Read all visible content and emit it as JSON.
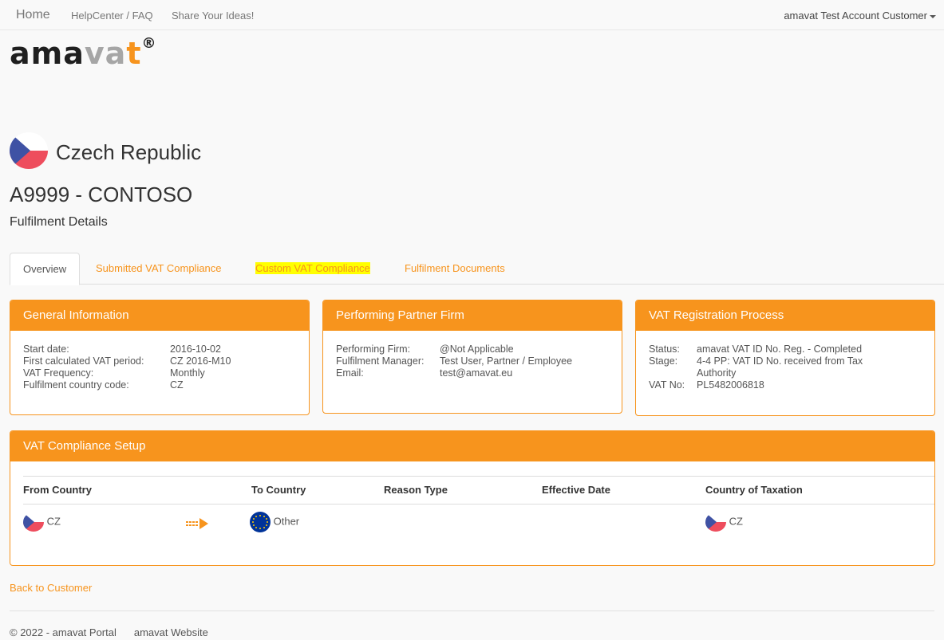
{
  "nav": {
    "home": "Home",
    "links": [
      "HelpCenter / FAQ",
      "Share Your Ideas!"
    ],
    "user": "amavat Test Account Customer"
  },
  "logo": {
    "part1": "ama",
    "part2": "va",
    "part3": "t",
    "reg": "®"
  },
  "country": {
    "name": "Czech Republic",
    "flag_icon": "czech-flag-icon"
  },
  "client": {
    "title": "A9999 - CONTOSO",
    "subtitle": "Fulfilment Details"
  },
  "tabs": [
    {
      "label": "Overview",
      "active": true
    },
    {
      "label": "Submitted VAT Compliance",
      "active": false
    },
    {
      "label": "Custom VAT Compliance",
      "active": false,
      "highlighted": true
    },
    {
      "label": "Fulfilment Documents",
      "active": false
    }
  ],
  "general": {
    "heading": "General Information",
    "rows": [
      {
        "k": "Start date:",
        "v": "2016-10-02"
      },
      {
        "k": "First calculated VAT period:",
        "v": "CZ 2016-M10"
      },
      {
        "k": "VAT Frequency:",
        "v": "Monthly"
      },
      {
        "k": "Fulfilment country code:",
        "v": "CZ"
      }
    ]
  },
  "partner": {
    "heading": "Performing Partner Firm",
    "rows": [
      {
        "k": "Performing Firm:",
        "v": "@Not Applicable"
      },
      {
        "k": "Fulfilment Manager:",
        "v": "Test User, Partner / Employee"
      },
      {
        "k": "Email:",
        "v": "test@amavat.eu"
      }
    ]
  },
  "registration": {
    "heading": "VAT Registration Process",
    "rows": [
      {
        "k": "Status:",
        "v": "amavat VAT ID No. Reg. - Completed"
      },
      {
        "k": "Stage:",
        "v": "4-4 PP: VAT ID No. received from Tax Authority"
      },
      {
        "k": "VAT No:",
        "v": "PL5482006818"
      }
    ]
  },
  "setup": {
    "heading": "VAT Compliance Setup",
    "columns": [
      "From Country",
      "To Country",
      "Reason Type",
      "Effective Date",
      "Country of Taxation"
    ],
    "row": {
      "from": "CZ",
      "arrow_icon": "arrow-right-icon",
      "to": "Other",
      "reason": "",
      "effective": "",
      "taxation": "CZ"
    }
  },
  "footer": {
    "back": "Back to Customer",
    "copyright": "© 2022 - amavat Portal",
    "website": "amavat Website"
  },
  "colors": {
    "accent": "#f7941d",
    "flag_red": "#ee4d5d",
    "flag_blue": "#3f52a4",
    "eu_blue": "#003399"
  }
}
